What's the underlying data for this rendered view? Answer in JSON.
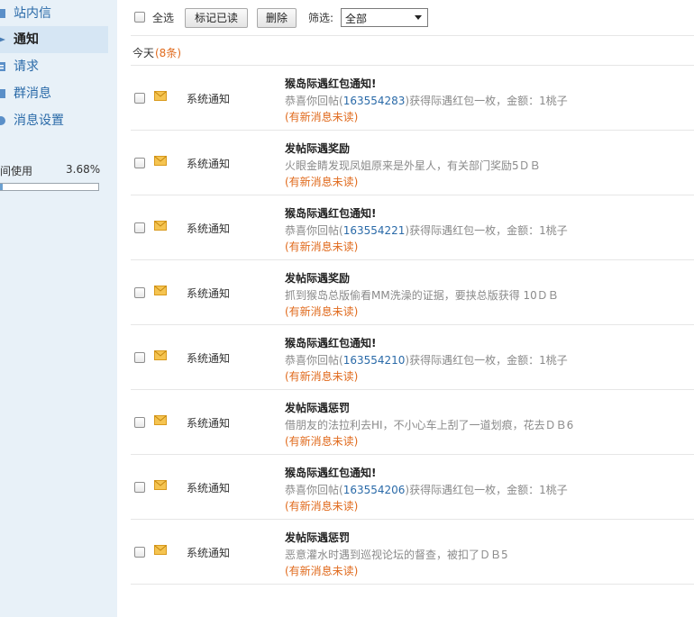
{
  "sidebar": {
    "items": [
      {
        "label": "站内信",
        "active": false,
        "icon": "mail-icon"
      },
      {
        "label": "通知",
        "active": true,
        "icon": "notice-icon"
      },
      {
        "label": "请求",
        "active": false,
        "icon": "request-icon"
      },
      {
        "label": "群消息",
        "active": false,
        "icon": "group-icon"
      },
      {
        "label": "消息设置",
        "active": false,
        "icon": "settings-icon"
      }
    ],
    "storage": {
      "label": "间使用",
      "percent_text": "3.68%",
      "percent": 3.68
    }
  },
  "toolbar": {
    "select_all": "全选",
    "mark_read": "标记已读",
    "delete": "删除",
    "filter_label": "筛选:",
    "filter_value": "全部"
  },
  "group": {
    "title": "今天",
    "count": "(8条)"
  },
  "messages": [
    {
      "type": "系统通知",
      "title": "猴岛际遇红包通知!",
      "body_pre": "恭喜你回帖(",
      "link": "163554283",
      "body_post": ")获得际遇红包一枚，金额：1桃子",
      "status": "(有新消息未读)"
    },
    {
      "type": "系统通知",
      "title": "发帖际遇奖励",
      "body_pre": "火眼金睛发现凤姐原来是外星人，有关部门奖励5ＤＢ",
      "link": "",
      "body_post": "",
      "status": "(有新消息未读)"
    },
    {
      "type": "系统通知",
      "title": "猴岛际遇红包通知!",
      "body_pre": "恭喜你回帖(",
      "link": "163554221",
      "body_post": ")获得际遇红包一枚，金额：1桃子",
      "status": "(有新消息未读)"
    },
    {
      "type": "系统通知",
      "title": "发帖际遇奖励",
      "body_pre": "抓到猴岛总版偷看MM洗澡的证据，要挟总版获得 10ＤＢ",
      "link": "",
      "body_post": "",
      "status": "(有新消息未读)"
    },
    {
      "type": "系统通知",
      "title": "猴岛际遇红包通知!",
      "body_pre": "恭喜你回帖(",
      "link": "163554210",
      "body_post": ")获得际遇红包一枚，金额：1桃子",
      "status": "(有新消息未读)"
    },
    {
      "type": "系统通知",
      "title": "发帖际遇惩罚",
      "body_pre": "借朋友的法拉利去HI，不小心车上刮了一道划痕，花去ＤＢ6",
      "link": "",
      "body_post": "",
      "status": "(有新消息未读)"
    },
    {
      "type": "系统通知",
      "title": "猴岛际遇红包通知!",
      "body_pre": "恭喜你回帖(",
      "link": "163554206",
      "body_post": ")获得际遇红包一枚，金额：1桃子",
      "status": "(有新消息未读)"
    },
    {
      "type": "系统通知",
      "title": "发帖际遇惩罚",
      "body_pre": "恶意灌水时遇到巡视论坛的督查，被扣了ＤＢ5",
      "link": "",
      "body_post": "",
      "status": "(有新消息未读)"
    }
  ],
  "colors": {
    "link": "#2a6aa8",
    "unread": "#e06a1c",
    "sidebar_bg": "#e8f1f8",
    "envelope": "#f0b429"
  }
}
